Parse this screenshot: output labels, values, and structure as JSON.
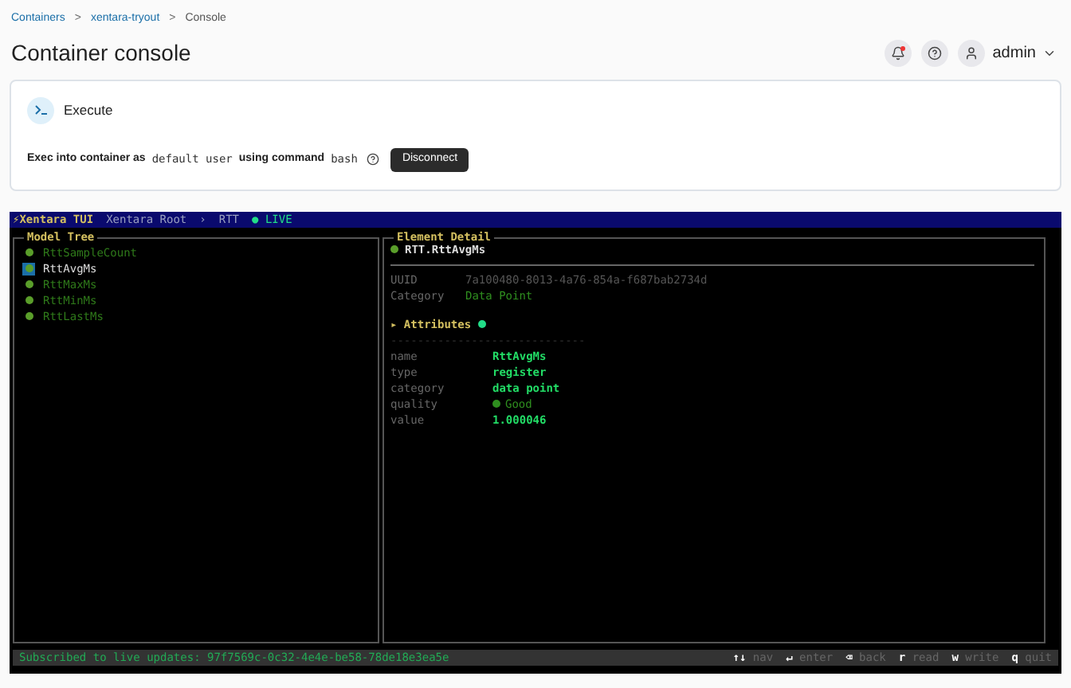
{
  "breadcrumb": [
    {
      "label": "Containers",
      "link": true
    },
    {
      "label": "xentara-tryout",
      "link": true
    },
    {
      "label": "Console",
      "link": false
    }
  ],
  "breadcrumb_separator": ">",
  "title": "Container console",
  "header": {
    "notifications_unread": true,
    "user": "admin"
  },
  "execute": {
    "title": "Execute",
    "sentence": [
      {
        "text": "Exec into container as",
        "code": false
      },
      {
        "text": "default user",
        "code": true
      },
      {
        "text": "using command",
        "code": false
      },
      {
        "text": "bash",
        "code": true
      }
    ],
    "button": "Disconnect"
  },
  "terminal": {
    "app": "⚡Xentara TUI",
    "path": [
      {
        "text": "Xentara Root"
      },
      {
        "text": "›"
      },
      {
        "text": "RTT"
      }
    ],
    "live": "● LIVE",
    "tree": {
      "title": "Model Tree",
      "items": [
        {
          "label": "RttSampleCount",
          "selected": false
        },
        {
          "label": "RttAvgMs",
          "selected": true
        },
        {
          "label": "RttMaxMs",
          "selected": false
        },
        {
          "label": "RttMinMs",
          "selected": false
        },
        {
          "label": "RttLastMs",
          "selected": false
        }
      ]
    },
    "detail": {
      "title": "Element Detail",
      "element": "RTT.RttAvgMs",
      "info": [
        {
          "key": "UUID",
          "value": "7a100480-8013-4a76-854a-f687bab2734d",
          "kind": "dim"
        },
        {
          "key": "Category",
          "value": "Data Point",
          "kind": "green"
        }
      ],
      "attributes_title": "▸ Attributes",
      "attributes_rule": "-----------------------------",
      "attributes": [
        {
          "key": "name",
          "value": "RttAvgMs",
          "kind": "bright"
        },
        {
          "key": "type",
          "value": "register",
          "kind": "bright"
        },
        {
          "key": "category",
          "value": "data point",
          "kind": "bright"
        },
        {
          "key": "quality",
          "value": "Good",
          "kind": "quality"
        },
        {
          "key": "value",
          "value": "1.000046",
          "kind": "bright"
        }
      ]
    },
    "status": "Subscribed to live updates: 97f7569c-0c32-4e4e-be58-78de18e3ea5e",
    "keys": [
      {
        "key": "↑↓",
        "label": "nav"
      },
      {
        "key": "↵",
        "label": "enter"
      },
      {
        "key": "⌫",
        "label": "back"
      },
      {
        "key": "r",
        "label": "read"
      },
      {
        "key": "w",
        "label": "write"
      },
      {
        "key": "q",
        "label": "quit"
      }
    ]
  }
}
